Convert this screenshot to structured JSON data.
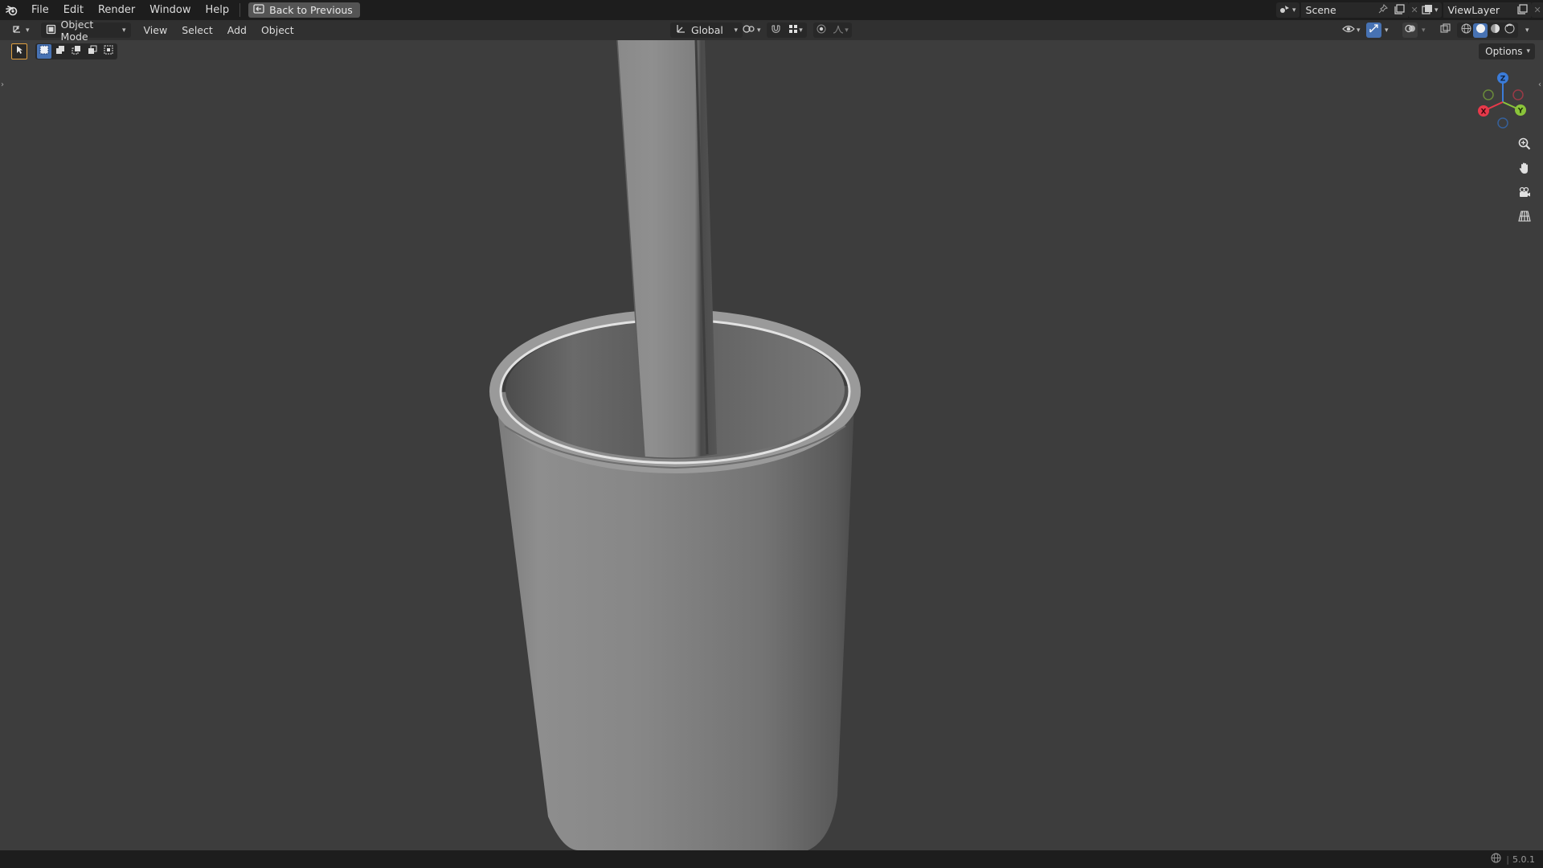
{
  "menu": {
    "items": [
      "File",
      "Edit",
      "Render",
      "Window",
      "Help"
    ],
    "back_button": "Back to Previous"
  },
  "scene": {
    "name": "Scene"
  },
  "view_layer": {
    "name": "ViewLayer"
  },
  "header": {
    "mode": "Object Mode",
    "menus": [
      "View",
      "Select",
      "Add",
      "Object"
    ],
    "transform_orientation": "Global"
  },
  "viewport": {
    "options_label": "Options",
    "gizmo": {
      "x_label": "X",
      "y_label": "Y",
      "z_label": "Z"
    }
  },
  "status": {
    "version": "5.0.1"
  },
  "colors": {
    "x_axis": "#e8394a",
    "y_axis": "#8ac43a",
    "z_axis": "#3b7cd9",
    "accent": "#4772b3"
  }
}
